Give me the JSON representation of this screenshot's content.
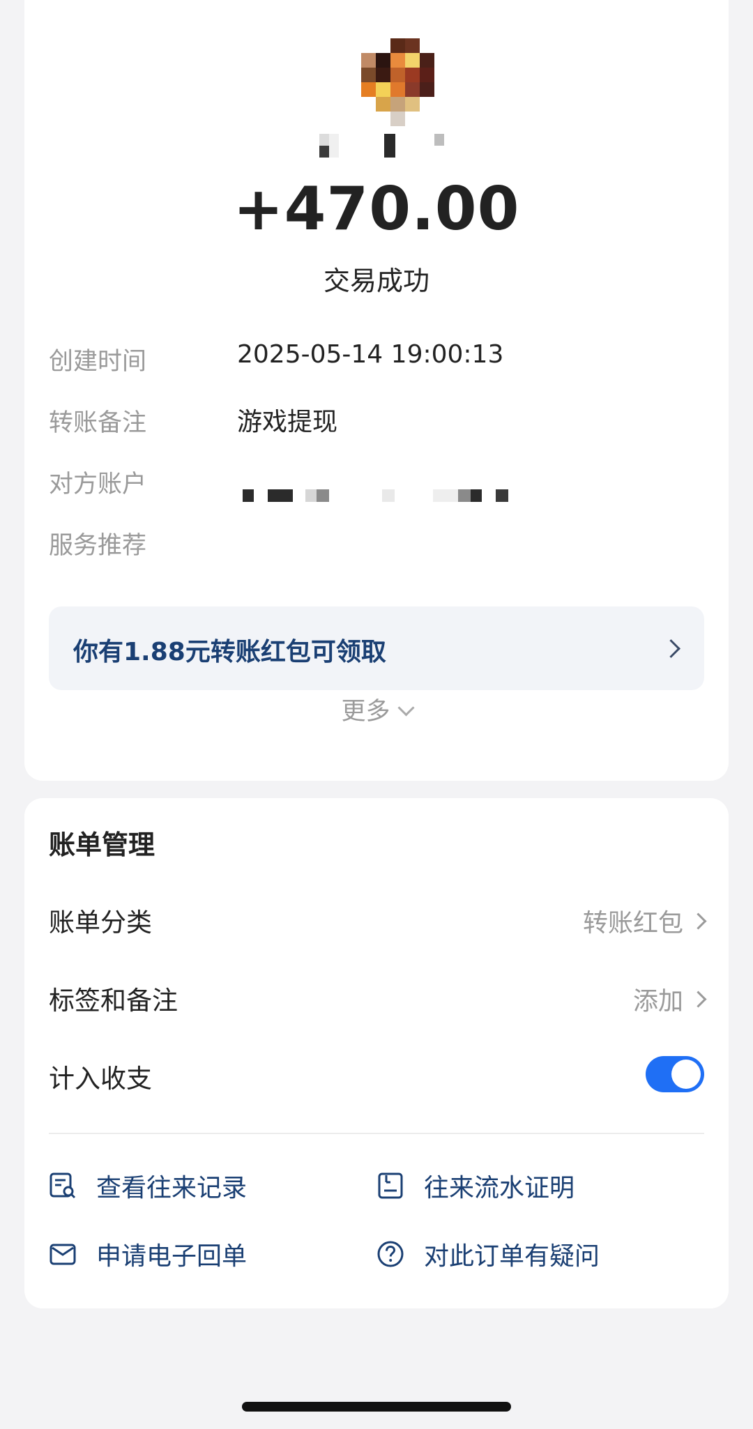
{
  "transaction": {
    "amount": "+470.00",
    "status": "交易成功",
    "rows": [
      {
        "label": "创建时间",
        "value": "2025-05-14 19:00:13"
      },
      {
        "label": "转账备注",
        "value": "游戏提现"
      },
      {
        "label": "对方账户",
        "value": ""
      },
      {
        "label": "服务推荐",
        "value": ""
      }
    ],
    "redpacket_banner": "你有1.88元转账红包可领取",
    "more_label": "更多"
  },
  "bill_management": {
    "title": "账单管理",
    "category_label": "账单分类",
    "category_value": "转账红包",
    "tags_label": "标签和备注",
    "tags_value": "添加",
    "include_label": "计入收支",
    "include_enabled": true,
    "actions": [
      {
        "label": "查看往来记录",
        "icon": "records-search-icon"
      },
      {
        "label": "往来流水证明",
        "icon": "statement-proof-icon"
      },
      {
        "label": "申请电子回单",
        "icon": "mail-icon"
      },
      {
        "label": "对此订单有疑问",
        "icon": "question-icon"
      }
    ]
  },
  "colors": {
    "accent": "#1f6ff5",
    "link_text": "#1a3f73",
    "muted": "#9a9a9a",
    "background": "#f3f3f5",
    "card": "#ffffff"
  }
}
